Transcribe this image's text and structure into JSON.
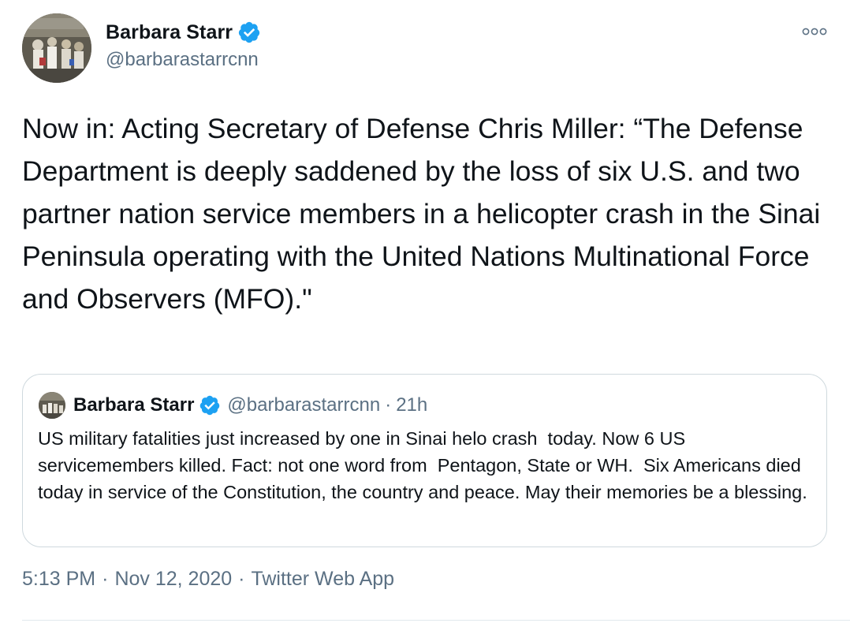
{
  "author": {
    "display_name": "Barbara Starr",
    "handle": "@barbarastarrcnn",
    "verified": true
  },
  "tweet": {
    "text": "Now in: Acting Secretary of Defense Chris Miller: “The Defense Department is deeply saddened by the loss of six U.S. and two partner nation service members in a helicopter crash in the Sinai Peninsula operating with the United Nations Multinational Force and Observers (MFO).\"",
    "time": "5:13 PM",
    "date": "Nov 12, 2020",
    "source": "Twitter Web App"
  },
  "quoted_tweet": {
    "display_name": "Barbara Starr",
    "handle": "@barbarastarrcnn",
    "separator": "·",
    "age": "21h",
    "text": "US military fatalities just increased by one in Sinai helo crash  today. Now 6 US servicemembers killed. Fact: not one word from  Pentagon, State or WH.  Six Americans died today in service of the Constitution, the country and peace. May their memories be a blessing."
  },
  "meta_separator": "·",
  "colors": {
    "verified_blue": "#1da1f2",
    "secondary_text": "#5b7083",
    "primary_text": "#0f1419",
    "border": "#cfd9de"
  },
  "icons": {
    "verified": "verified-badge-icon",
    "more": "more-options-icon"
  }
}
